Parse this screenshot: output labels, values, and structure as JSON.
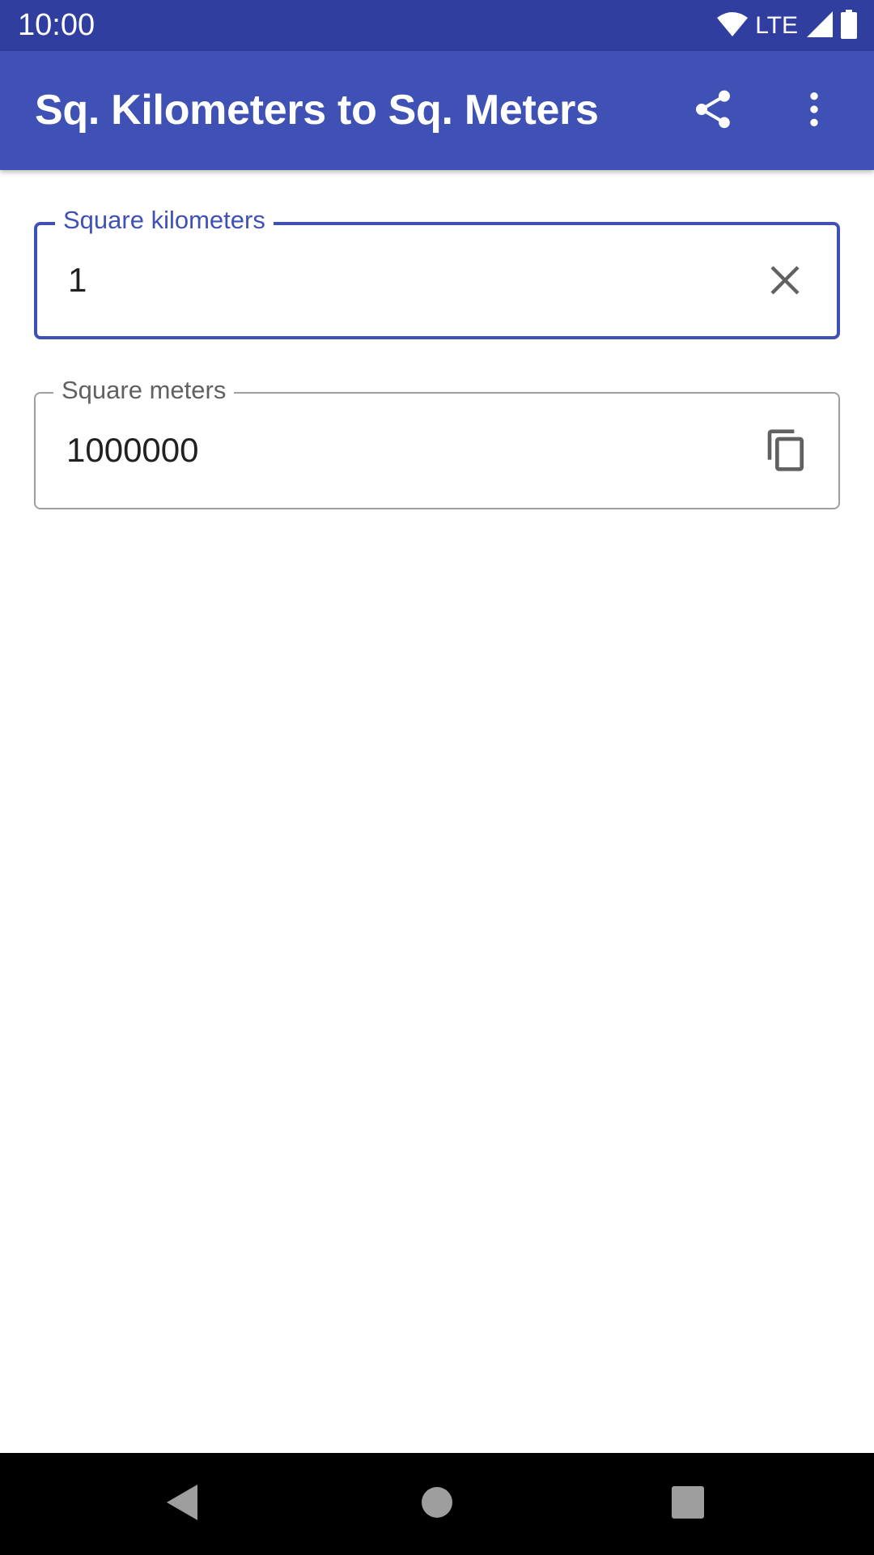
{
  "status_bar": {
    "time": "10:00",
    "network": "LTE",
    "icons": [
      "wifi-icon",
      "signal-icon",
      "battery-icon"
    ]
  },
  "app_bar": {
    "title": "Sq. Kilometers to Sq. Meters",
    "actions": [
      "share-icon",
      "more-vert-icon"
    ]
  },
  "input_field": {
    "label": "Square kilometers",
    "value": "1",
    "action_icon": "clear-icon"
  },
  "output_field": {
    "label": "Square meters",
    "value": "1000000",
    "action_icon": "copy-icon"
  },
  "nav_bar": {
    "buttons": [
      "back-icon",
      "home-icon",
      "recents-icon"
    ]
  },
  "colors": {
    "status_bar": "#303f9f",
    "app_bar": "#3f51b5",
    "accent": "#3f51b5",
    "nav_bar": "#000000"
  }
}
